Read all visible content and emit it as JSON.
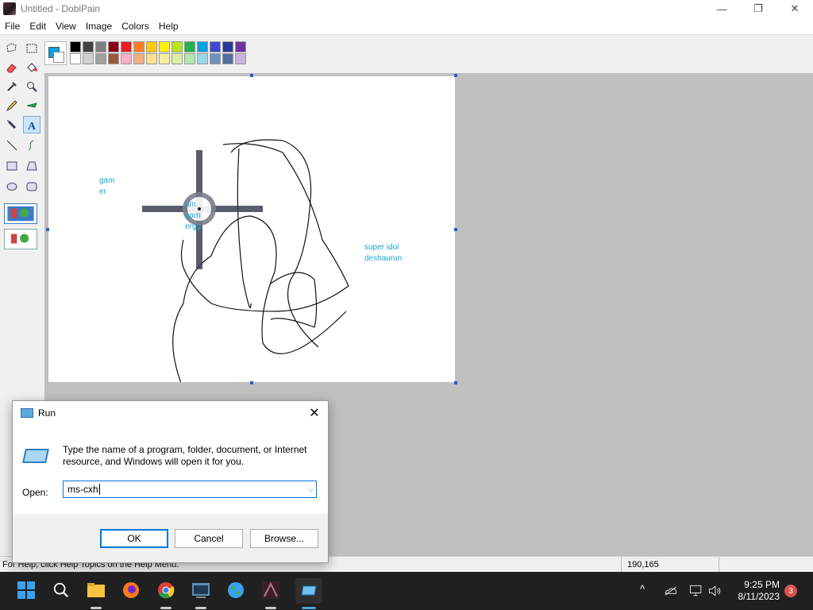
{
  "window": {
    "title": "Untitled - DobiPain",
    "controls": {
      "minimize": "—",
      "maximize": "❐",
      "close": "✕"
    }
  },
  "menu": [
    "File",
    "Edit",
    "View",
    "Image",
    "Colors",
    "Help"
  ],
  "palette": {
    "foreground": "#00a2e8",
    "background": "#ffffff",
    "row1": [
      "#000000",
      "#404040",
      "#7f7f7f",
      "#880015",
      "#ed1c24",
      "#ff7f27",
      "#ffc90e",
      "#fff200",
      "#b5e61d",
      "#22b14c",
      "#00a2e8",
      "#3f48cc",
      "#2a3a9a",
      "#7030a0"
    ],
    "row2": [
      "#ffffff",
      "#d0d0d0",
      "#a0a0a0",
      "#9c5a3c",
      "#ffaec9",
      "#f0b080",
      "#ffe090",
      "#f8f0a0",
      "#d8f0a0",
      "#b0e8b0",
      "#99d9ea",
      "#7092be",
      "#5070a0",
      "#c8b4e0"
    ]
  },
  "canvas": {
    "texts": [
      "gam\ner",
      "am\ngam\nergg",
      "super idol\ndeshaurun"
    ]
  },
  "status": {
    "help": "For Help, click Help Topics on the Help Menu.",
    "coords": "190,165"
  },
  "run_dialog": {
    "title": "Run",
    "close": "✕",
    "description": "Type the name of a program, folder, document, or Internet resource, and Windows will open it for you.",
    "open_label": "Open:",
    "open_value": "ms-cxh",
    "buttons": {
      "ok": "OK",
      "cancel": "Cancel",
      "browse": "Browse..."
    }
  },
  "taskbar": {
    "apps": [
      "start-icon",
      "search-icon",
      "file-explorer-icon",
      "firefox-icon",
      "chrome-icon",
      "terminal-icon",
      "globe-icon",
      "dobipain-icon",
      "run-icon"
    ],
    "tray": {
      "chevron": "^"
    },
    "clock": {
      "time": "9:25 PM",
      "date": "8/11/2023"
    },
    "notifications": "3"
  }
}
